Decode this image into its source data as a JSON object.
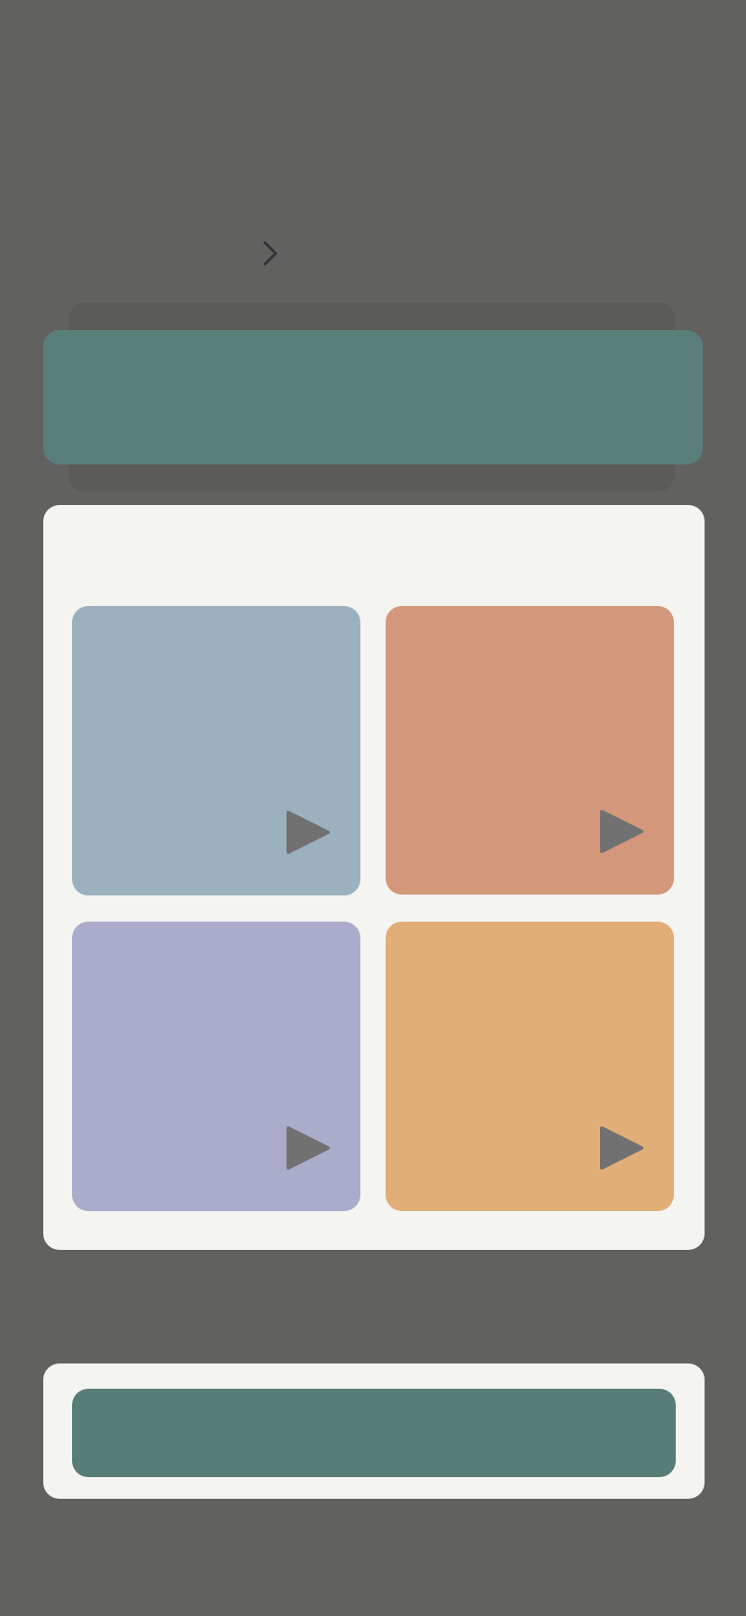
{
  "colors": {
    "background": "#616160",
    "banner": "#5a7f7b",
    "banner_shadow": "#5a5a57",
    "panel": "#f4f4f0",
    "footer_button": "#587c78",
    "play_icon": "#717171",
    "chevron": "#2f3332"
  },
  "navigation": {
    "chevron_icon": "chevron-right-icon"
  },
  "tiles": [
    {
      "color": "#9cb1c0",
      "icon": "play-icon"
    },
    {
      "color": "#d3977b",
      "icon": "play-icon"
    },
    {
      "color": "#abaccb",
      "icon": "play-icon"
    },
    {
      "color": "#e2ae78",
      "icon": "play-icon"
    }
  ]
}
